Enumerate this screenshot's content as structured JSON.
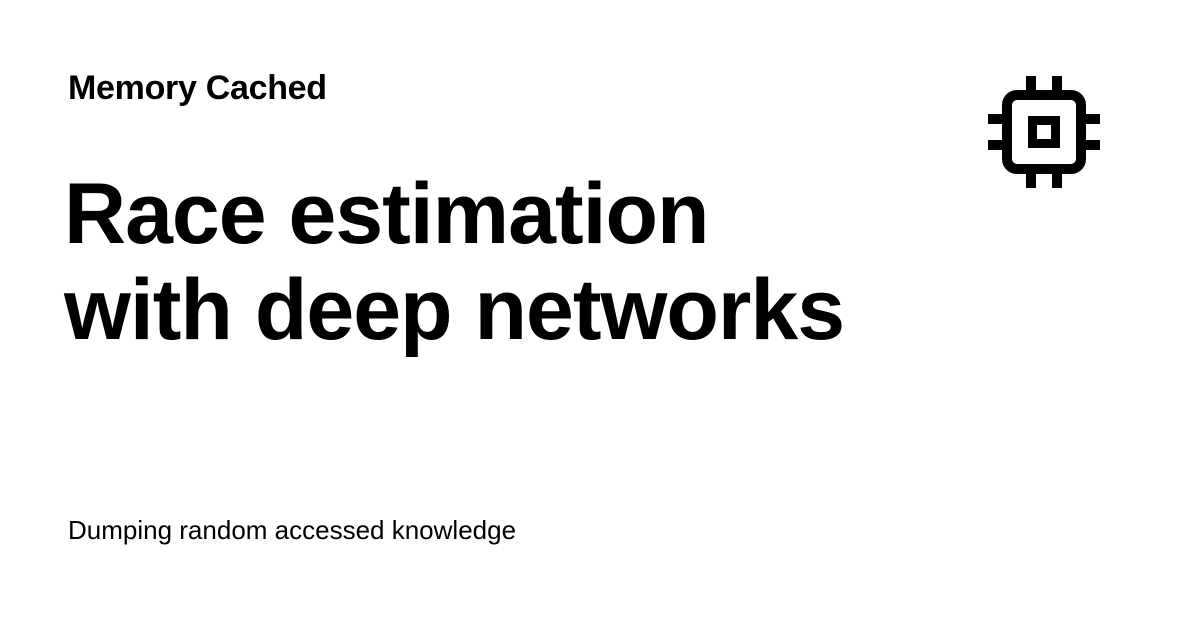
{
  "site": {
    "name": "Memory Cached",
    "tagline": "Dumping random accessed knowledge"
  },
  "post": {
    "title_lines": [
      "Race estimation",
      "with deep networks"
    ]
  },
  "logo": {
    "icon": "cpu-chip-icon"
  },
  "colors": {
    "background": "#ffffff",
    "text": "#000000"
  }
}
